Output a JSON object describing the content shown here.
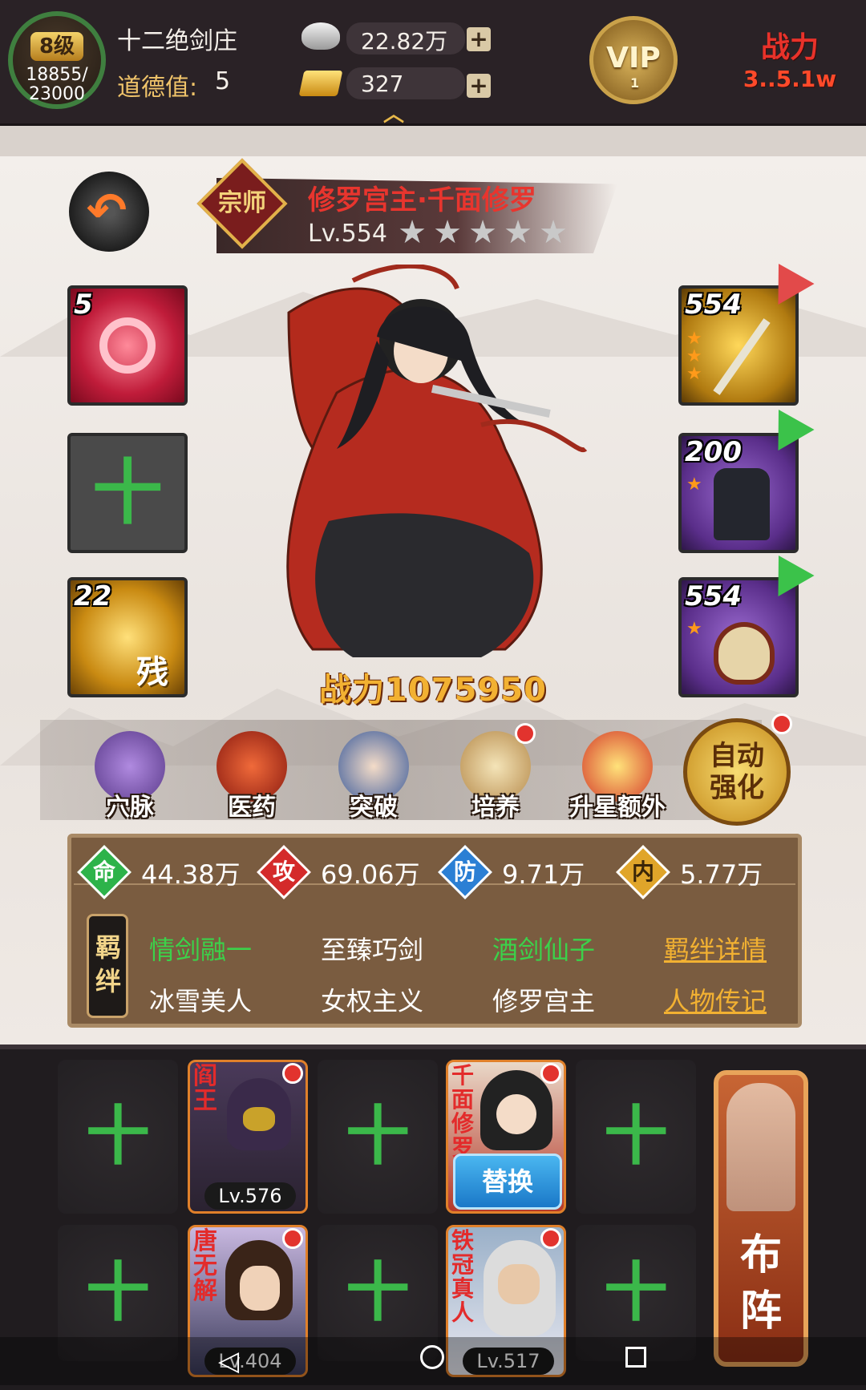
{
  "topbar": {
    "level": "8级",
    "exp": "18855/\n23000",
    "guild_name": "十二绝剑庄",
    "morality_label": "道德值:",
    "morality_value": "5",
    "silver": "22.82万",
    "gold": "327",
    "vip_label": "VIP",
    "vip_level": "1",
    "power_label": "战力",
    "power_value": "3..5.1w"
  },
  "hero": {
    "grade": "宗师",
    "name": "修罗宫主·千面修罗",
    "level": "Lv.554",
    "stars": 5,
    "power": "战力1075950"
  },
  "left_slots": [
    {
      "count": "5"
    },
    {
      "count": ""
    },
    {
      "count": "22",
      "tag": "残"
    }
  ],
  "right_slots": [
    {
      "level": "554"
    },
    {
      "level": "200"
    },
    {
      "level": "554"
    }
  ],
  "actions": [
    {
      "label": "穴脉",
      "icon": "meridian-icon",
      "dot": false
    },
    {
      "label": "医药",
      "icon": "medicine-icon",
      "dot": false
    },
    {
      "label": "突破",
      "icon": "breakthrough-icon",
      "dot": false
    },
    {
      "label": "培养",
      "icon": "cultivate-icon",
      "dot": true
    },
    {
      "label": "升星额外",
      "icon": "star-up-icon",
      "dot": false
    }
  ],
  "auto_enhance": "自动\n强化",
  "stats": [
    {
      "icon": "命",
      "value": "44.38万",
      "color": "#2db34a"
    },
    {
      "icon": "攻",
      "value": "69.06万",
      "color": "#d42a2a"
    },
    {
      "icon": "防",
      "value": "9.71万",
      "color": "#2b7fd4"
    },
    {
      "icon": "内",
      "value": "5.77万",
      "color": "#e0a52a"
    }
  ],
  "bonds_title": "羁绊",
  "bonds": [
    {
      "text": "情剑融一",
      "active": true
    },
    {
      "text": "至臻巧剑",
      "active": false
    },
    {
      "text": "酒剑仙子",
      "active": true
    },
    {
      "text": "冰雪美人",
      "active": false
    },
    {
      "text": "女权主义",
      "active": false
    },
    {
      "text": "修罗宫主",
      "active": false
    }
  ],
  "links": {
    "bond_detail": "羁绊详情",
    "biography": "人物传记"
  },
  "roster": {
    "row1": [
      {
        "empty": true
      },
      {
        "name": "阎王",
        "level": "Lv.576",
        "dot": true
      },
      {
        "empty": true
      },
      {
        "name": "千面修罗",
        "button": "替换",
        "dot": true
      },
      {
        "empty": true
      }
    ],
    "row2": [
      {
        "empty": true
      },
      {
        "name": "唐无解",
        "level": "Lv.404",
        "dot": true
      },
      {
        "empty": true
      },
      {
        "name": "铁冠真人",
        "level": "Lv.517",
        "dot": true
      },
      {
        "empty": true
      }
    ],
    "formation": "布\n阵"
  },
  "colors": {
    "accent_gold": "#f2b132",
    "green_active": "#3bd24a",
    "red_name": "#e32b2b"
  }
}
